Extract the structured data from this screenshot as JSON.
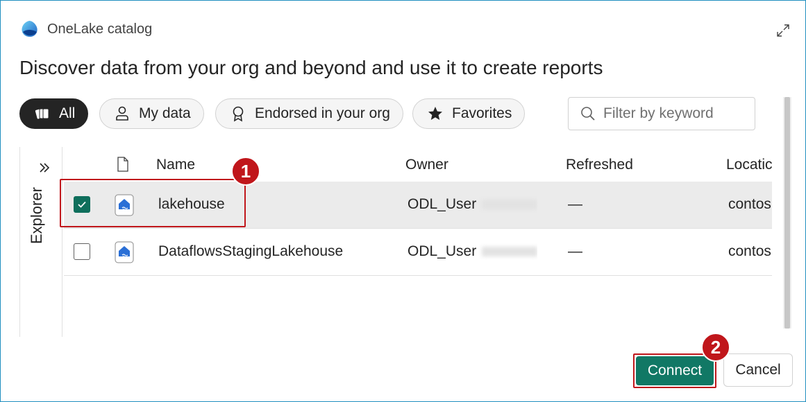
{
  "dialog": {
    "app_title": "OneLake catalog",
    "headline": "Discover data from your org and beyond and use it to create reports"
  },
  "filters": [
    {
      "label": "All",
      "icon": "stack-icon",
      "active": true
    },
    {
      "label": "My data",
      "icon": "person-icon",
      "active": false
    },
    {
      "label": "Endorsed in your org",
      "icon": "ribbon-icon",
      "active": false
    },
    {
      "label": "Favorites",
      "icon": "star-icon",
      "active": false
    }
  ],
  "search": {
    "placeholder": "Filter by keyword",
    "value": ""
  },
  "explorer": {
    "label": "Explorer"
  },
  "table": {
    "columns": [
      "Name",
      "Owner",
      "Refreshed",
      "Locatic"
    ],
    "rows": [
      {
        "name": "lakehouse",
        "owner": "ODL_User",
        "refreshed": "—",
        "location": "contos",
        "selected": true
      },
      {
        "name": "DataflowsStagingLakehouse",
        "owner": "ODL_User",
        "refreshed": "—",
        "location": "contos",
        "selected": false
      }
    ]
  },
  "annotations": {
    "step1": "1",
    "step2": "2"
  },
  "footer": {
    "connect_label": "Connect",
    "cancel_label": "Cancel"
  },
  "colors": {
    "accent": "#117865",
    "annotation": "#c0161b",
    "active_pill": "#242424"
  }
}
